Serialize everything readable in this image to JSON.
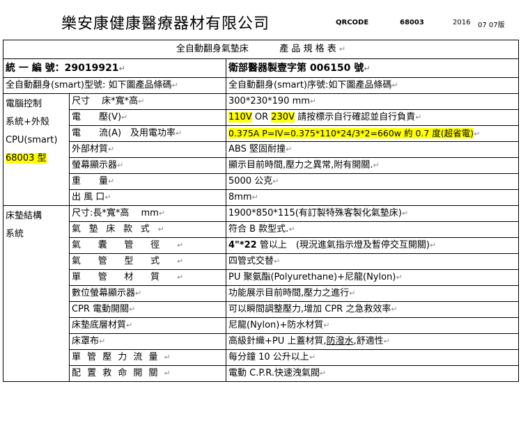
{
  "header": {
    "company": "樂安康健康醫療器材有限公司",
    "qrcode_label": "QRCODE",
    "model_no": "68003",
    "year": "2016",
    "date": "07 07版"
  },
  "title": {
    "left": "全自動翻身氣墊床",
    "right": "產 品 規 格 表"
  },
  "mark": "↵",
  "registration": {
    "uniform_no": "統 一 編 號：29019921",
    "license": "衛部醫器製壹字第 006150 號"
  },
  "barcodes": {
    "model": "全自動翻身(smart)型號: 如下圖產品條碼",
    "serial": "全自動翻身(smart)序號:如下圖產品條碼"
  },
  "group1": {
    "label_lines": [
      "電腦控制",
      "系統+外殼",
      "CPU(smart)",
      "68003 型"
    ],
    "rows": [
      {
        "label": "尺寸　 床*寬*高",
        "value": "300*230*190 mm"
      },
      {
        "label": "電　　壓(V)",
        "value_hl1": "110V",
        "value_mid": " OR ",
        "value_hl2": "230V",
        "value_rest": " 請按標示自行確認並自行負責"
      },
      {
        "label": "電　　流(A)　及用電功率",
        "value": "0.375A P=IV=0.375*110*24/3*2=660w 約 0.7 度(超省電)"
      },
      {
        "label": "外部材質",
        "value": "ABS 堅固耐撞"
      },
      {
        "label": "螢幕顯示器",
        "value": "顯示目前時間,壓力之異常,附有開關."
      },
      {
        "label": "重　　量",
        "value": "5000 公克"
      },
      {
        "label": "出 風 口",
        "value": "8mm"
      }
    ]
  },
  "group2": {
    "label_lines": [
      "床墊結構",
      "系統"
    ],
    "rows": [
      {
        "label": "尺寸:長*寬*高　 mm",
        "value": "1900*850*115(有訂製特殊客製化氣墊床)"
      },
      {
        "label": "氣墊床款式",
        "value": "符合 B 款型式."
      },
      {
        "label": "氣囊管徑",
        "value_bold": "4\"*22",
        "value_rest": " 管以上　(現況進氣指示燈及暫停交互開關)"
      },
      {
        "label": "氣管型式",
        "value": "四管式交替"
      },
      {
        "label": "單管材質",
        "value": "PU 聚氨酯(Polyurethane)+尼龍(Nylon)"
      },
      {
        "label": "數位螢幕顯示器",
        "value": "功能展示目前時間,壓力之進行"
      },
      {
        "label": "CPR 電動開關",
        "value": "可以瞬間調整壓力,增加 CPR 之急救效率"
      },
      {
        "label": "床墊底層材質",
        "value": "尼龍(Nylon)+防水材質"
      },
      {
        "label": "床罩布",
        "value_pre": "高級針織+PU 上蓋材質,",
        "value_ul": "防潑水",
        "value_rest": ",舒適性"
      },
      {
        "label": "單管壓力流量",
        "value": "每分鐘 10 公升以上"
      },
      {
        "label": "配置救命開關",
        "value": "電動 C.P.R.快速洩氣閥"
      }
    ]
  }
}
